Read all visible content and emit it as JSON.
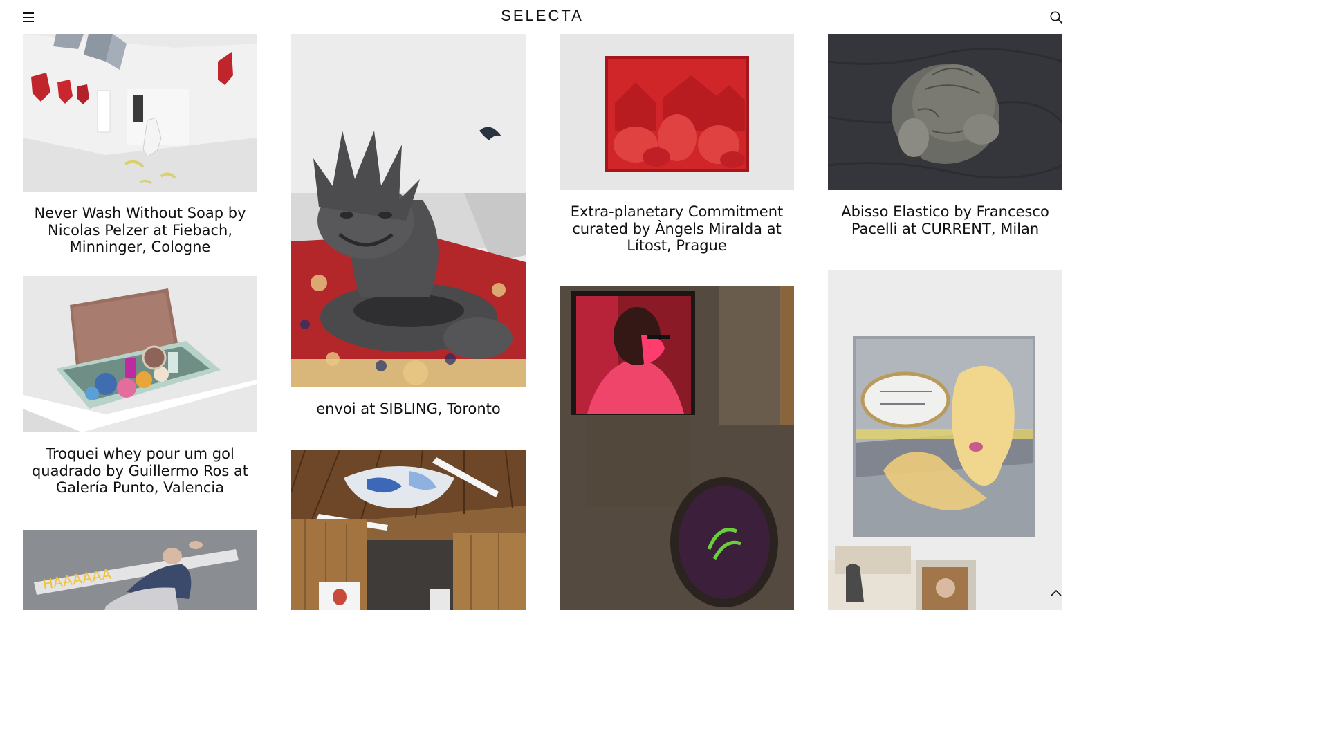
{
  "header": {
    "brand": "SELECTA",
    "menu_icon": "hamburger-menu-icon",
    "search_icon": "search-icon"
  },
  "posts": [
    {
      "id": "p1",
      "caption": "Never Wash Without Soap by Nicolas Pelzer at Fiebach, Minninger, Cologne"
    },
    {
      "id": "p2",
      "caption": "Troquei whey pour um gol quadrado by Guillermo Ros at Galería Punto, Valencia"
    },
    {
      "id": "p3",
      "caption": ""
    },
    {
      "id": "p4",
      "caption": "envoi at SIBLING, Toronto"
    },
    {
      "id": "p5",
      "caption": ""
    },
    {
      "id": "p6",
      "caption": "Extra-planetary Commitment curated by Àngels Miralda at Lítost, Prague"
    },
    {
      "id": "p7",
      "caption": ""
    },
    {
      "id": "p8",
      "caption": "Abisso Elastico by Francesco Pacelli at CURRENT, Milan"
    },
    {
      "id": "p9",
      "caption": ""
    }
  ],
  "colors": {
    "background": "#ffffff",
    "text": "#111111"
  },
  "back_to_top_icon": "chevron-up-icon"
}
